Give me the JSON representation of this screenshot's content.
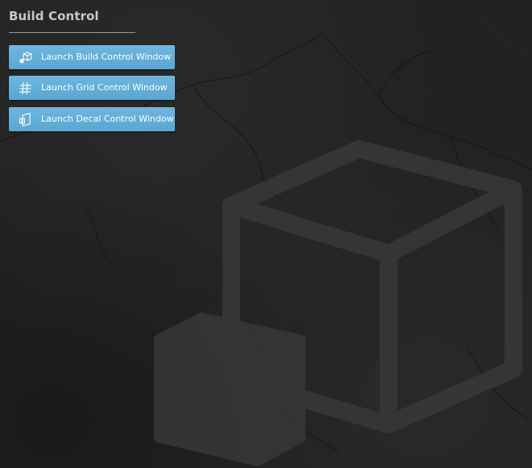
{
  "panel": {
    "title": "Build Control"
  },
  "buttons": [
    {
      "label": "Launch Build Control Window",
      "icon": "build-cube-icon"
    },
    {
      "label": "Launch Grid Control Window",
      "icon": "grid-hash-icon"
    },
    {
      "label": "Launch Decal Control Window",
      "icon": "decal-icon"
    }
  ],
  "colors": {
    "background": "#222222",
    "button": "#5aa7d3",
    "title_text": "#c9c9c9",
    "button_text": "#ffffff"
  },
  "background_art": {
    "watermark": "cube-watermark-icon"
  }
}
